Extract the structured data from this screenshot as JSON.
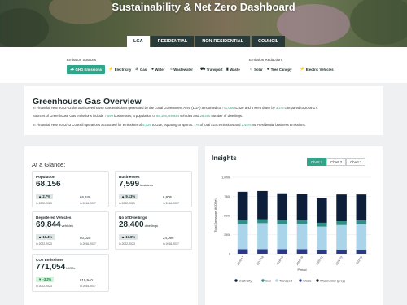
{
  "hero": {
    "title": "Sustainability & Net Zero Dashboard"
  },
  "tabs": [
    {
      "label": "LGA",
      "active": true
    },
    {
      "label": "RESIDENTIAL"
    },
    {
      "label": "NON-RESIDENTIAL"
    },
    {
      "label": "COUNCIL"
    }
  ],
  "filters": {
    "sources_label": "Emission Sources",
    "reduction_label": "Emission Reduction",
    "sources": [
      {
        "label": "GHG Emissions",
        "icon": "cloud-icon",
        "active": true
      },
      {
        "label": "Electricity",
        "icon": "bolt-icon"
      },
      {
        "label": "Gas",
        "icon": "flame-icon"
      },
      {
        "label": "Water",
        "icon": "water-drop-icon"
      },
      {
        "label": "Wastewater",
        "icon": "wastewater-icon"
      },
      {
        "label": "Transport",
        "icon": "car-icon"
      },
      {
        "label": "Waste",
        "icon": "trash-icon"
      }
    ],
    "reduction": [
      {
        "label": "Solar",
        "icon": "sun-icon"
      },
      {
        "label": "Tree Canopy",
        "icon": "tree-icon"
      },
      {
        "label": "Electric Vehicles",
        "icon": "ev-icon"
      }
    ]
  },
  "overview": {
    "title": "Greenhouse Gas Overview",
    "p1_a": "In Financial Year 2022-23 the total Greenhouse Gas emissions generated by the Local Government Area (LGA) amounted to ",
    "p1_h1": "771,054",
    "p1_b": " tCo2e and it went down by ",
    "p1_h2": "3.2%",
    "p1_c": " compared to 2016-17.",
    "p2_a": "Sources of Greenhouse Gas emissions include ",
    "p2_h1": "7,599",
    "p2_b": " businesses, a population of ",
    "p2_h2": "68,156",
    "p2_c": ", ",
    "p2_h3": "69,844",
    "p2_d": " vehicles and ",
    "p2_h4": "28,400",
    "p2_e": " number of dwellings.",
    "p3_a": "In Financial Year 2022/23 Council operations accounted for emissions of ",
    "p3_h1": "6,129",
    "p3_b": " tCO2e, equating to approx. ",
    "p3_h2": "1%",
    "p3_c": " of total LGA emissions and ",
    "p3_h3": "2.45%",
    "p3_d": " non-residential business emissions."
  },
  "glance": {
    "title": "At a Glance:",
    "cards": [
      {
        "title": "Population",
        "value": "68,156",
        "unit": "",
        "change": "2.7%",
        "dir": "up",
        "cur_label": "in 2022-2023",
        "prev": "66,346",
        "prev_label": "in 2016-2017"
      },
      {
        "title": "Businesses",
        "value": "7,599",
        "unit": "business",
        "change": "9.13%",
        "dir": "up",
        "cur_label": "in 2022-2023",
        "prev": "6,905",
        "prev_label": "in 2016-2017"
      },
      {
        "title": "Registered Vehicles",
        "value": "69,844",
        "unit": "vehicles",
        "change": "16.4%",
        "dir": "up",
        "cur_label": "in 2022-2023",
        "prev": "60,025",
        "prev_label": "in 2016-2017"
      },
      {
        "title": "No of Dwellings",
        "value": "28,400",
        "unit": "dwellings",
        "change": "17.8%",
        "dir": "up",
        "cur_label": "in 2022-2023",
        "prev": "24,099",
        "prev_label": "in 2016-2017"
      },
      {
        "title": "CO2 Emissions",
        "value": "771,054",
        "unit": "tCO2e",
        "change": "-3.2%",
        "dir": "down",
        "cur_label": "in 2022-2023",
        "prev": "810,940",
        "prev_label": "in 2016-2017"
      }
    ]
  },
  "insights": {
    "title": "Insights",
    "chart_tabs": [
      {
        "label": "Chart 1",
        "active": true
      },
      {
        "label": "Chart 2"
      },
      {
        "label": "Chart 3"
      }
    ]
  },
  "colors": {
    "accent": "#2fa58a",
    "electricity": "#0d1e3a",
    "gas": "#2f8f86",
    "transport": "#a9d4ea",
    "waste": "#2a3a88",
    "wastewater": "#1c2b2b"
  },
  "chart_data": {
    "type": "bar",
    "stacked": true,
    "ylabel": "Total Emissions (tCO2e)",
    "xlabel": "Period",
    "yticks": [
      "1,000k",
      "750k",
      "500k",
      "250k",
      "0"
    ],
    "ylim": [
      0,
      1000000
    ],
    "categories": [
      "2016-17",
      "2017-18",
      "2018-19",
      "2019-20",
      "2020-21",
      "2021-22",
      "2022-23"
    ],
    "series": [
      {
        "name": "Waste",
        "values": [
          60000,
          60000,
          60000,
          60000,
          55000,
          55000,
          55000
        ]
      },
      {
        "name": "Transport",
        "values": [
          330000,
          340000,
          330000,
          330000,
          300000,
          320000,
          330000
        ]
      },
      {
        "name": "Gas",
        "values": [
          50000,
          50000,
          50000,
          50000,
          50000,
          50000,
          50000
        ]
      },
      {
        "name": "Electricity",
        "values": [
          370000,
          370000,
          350000,
          340000,
          320000,
          350000,
          340000
        ]
      },
      {
        "name": "Wastewater (proj.)",
        "values": [
          0,
          0,
          0,
          0,
          0,
          0,
          0
        ]
      }
    ],
    "legend": "bottom"
  }
}
